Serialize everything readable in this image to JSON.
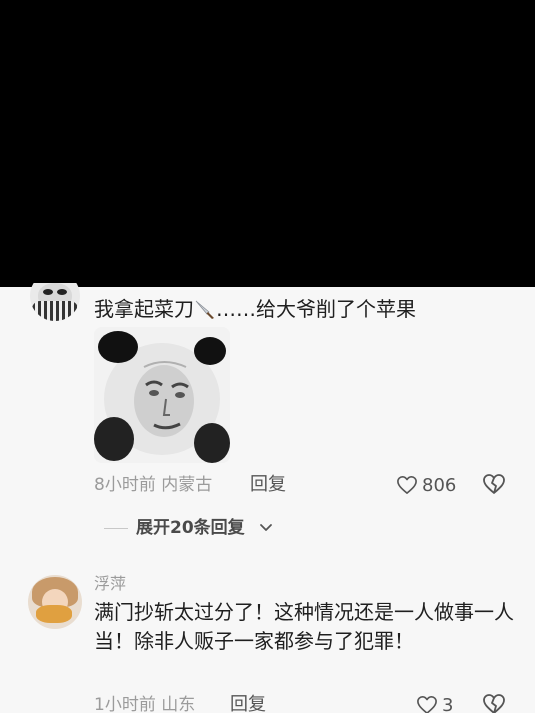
{
  "comments": [
    {
      "text_before": "我拿起菜刀",
      "text_after": "……给大爷削了个苹果",
      "image": "panda-meme-sticker",
      "time_location": "8小时前 内蒙古",
      "reply_label": "回复",
      "likes": "806",
      "expand_replies": "展开20条回复"
    },
    {
      "username": "浮萍",
      "text": "满门抄斩太过分了！这种情况还是一人做事一人当！除非人贩子一家都参与了犯罪！",
      "time_location": "1小时前 山东",
      "reply_label": "回复",
      "likes": "3"
    }
  ],
  "icons": {
    "like": "heart-icon",
    "dislike": "broken-heart-icon",
    "expand": "chevron-down-icon",
    "emoji": "knife-emoji-icon"
  },
  "colors": {
    "video_area": "#000000",
    "background": "#f7f7f7",
    "meta_text": "#9b9b9b"
  }
}
